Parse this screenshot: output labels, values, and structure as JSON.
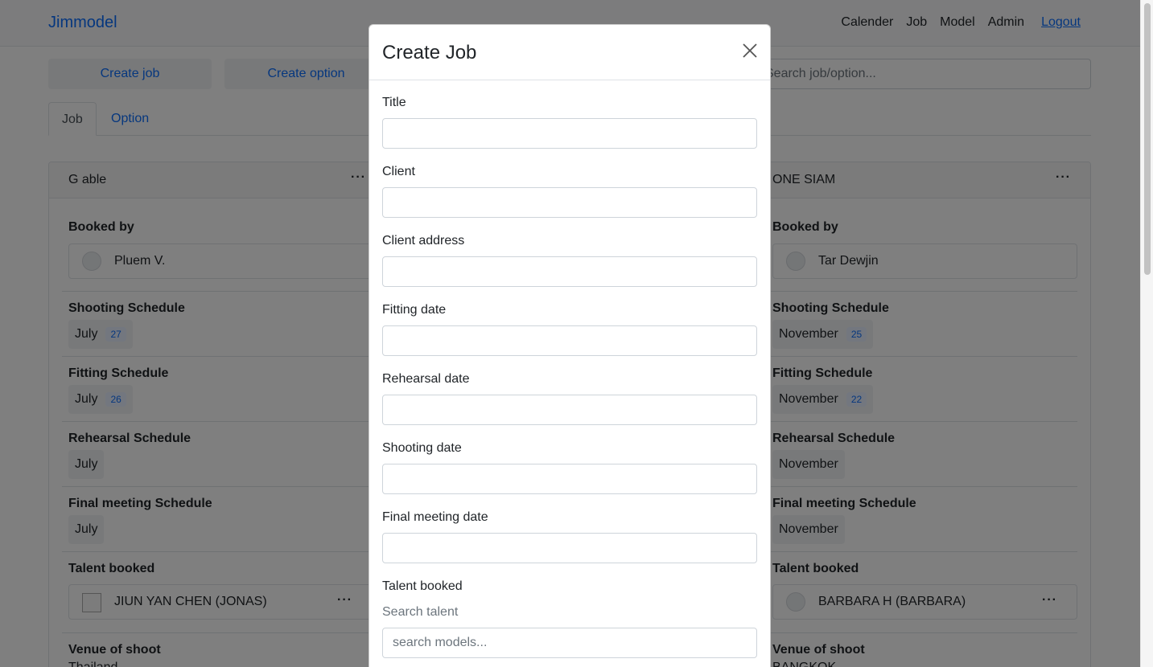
{
  "navbar": {
    "brand": "Jimmodel",
    "links": [
      "Calender",
      "Job",
      "Model",
      "Admin"
    ],
    "logout": "Logout"
  },
  "actions": {
    "create_job": "Create job",
    "create_option": "Create option",
    "search_placeholder": "Search job/option..."
  },
  "tabs": [
    "Job",
    "Option"
  ],
  "cards": [
    {
      "title": "G able",
      "booked_by_label": "Booked by",
      "booked_by": "Pluem V.",
      "shooting_label": "Shooting Schedule",
      "shooting_month": "July",
      "shooting_day": "27",
      "fitting_label": "Fitting Schedule",
      "fitting_month": "July",
      "fitting_day": "26",
      "rehearsal_label": "Rehearsal Schedule",
      "rehearsal_month": "July",
      "final_label": "Final meeting Schedule",
      "final_month": "July",
      "talent_label": "Talent booked",
      "talent": "JIUN YAN CHEN (JONAS)",
      "venue_label": "Venue of shoot",
      "venue": "Thailand"
    },
    {
      "title": "ONE SIAM",
      "booked_by_label": "Booked by",
      "booked_by": "Tar Dewjin",
      "shooting_label": "Shooting Schedule",
      "shooting_month": "November",
      "shooting_day": "25",
      "fitting_label": "Fitting Schedule",
      "fitting_month": "November",
      "fitting_day": "22",
      "rehearsal_label": "Rehearsal Schedule",
      "rehearsal_month": "November",
      "final_label": "Final meeting Schedule",
      "final_month": "November",
      "talent_label": "Talent booked",
      "talent": "BARBARA H (BARBARA)",
      "venue_label": "Venue of shoot",
      "venue": "BANGKOK"
    }
  ],
  "modal": {
    "title": "Create Job",
    "fields": {
      "title": {
        "label": "Title",
        "value": ""
      },
      "client": {
        "label": "Client",
        "value": ""
      },
      "client_address": {
        "label": "Client address",
        "value": ""
      },
      "fitting_date": {
        "label": "Fitting date",
        "value": ""
      },
      "rehearsal_date": {
        "label": "Rehearsal date",
        "value": ""
      },
      "shooting_date": {
        "label": "Shooting date",
        "value": ""
      },
      "final_meeting_date": {
        "label": "Final meeting date",
        "value": ""
      }
    },
    "talent_label": "Talent booked",
    "search_talent_label": "Search talent",
    "search_models_placeholder": "search models..."
  },
  "colors": {
    "link": "#0d6efd",
    "backdrop": "rgba(0,0,0,0.5)"
  }
}
